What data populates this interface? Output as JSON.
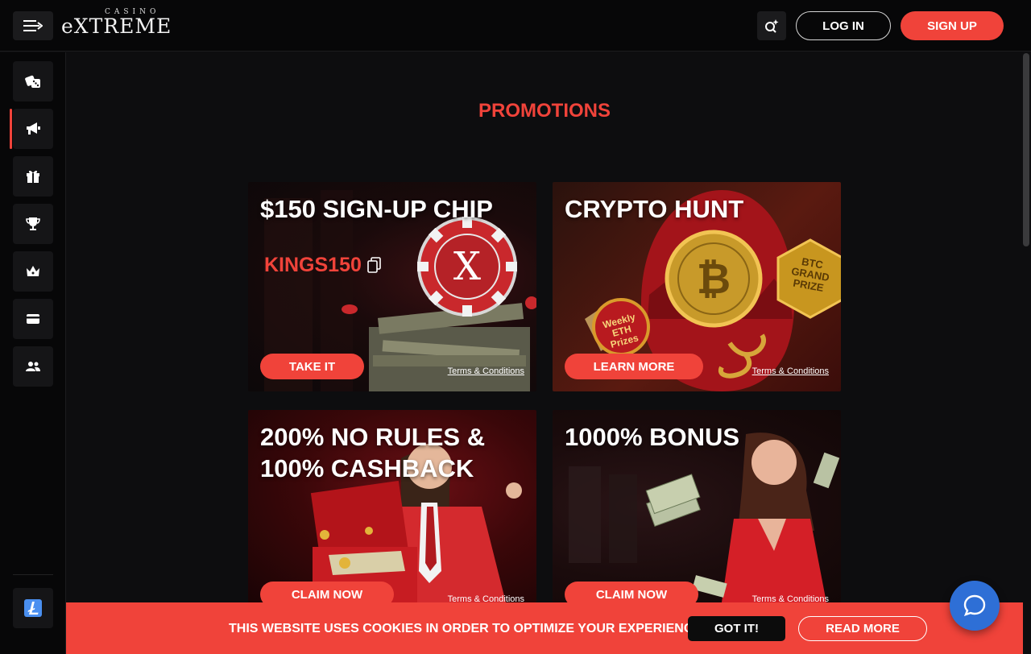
{
  "header": {
    "logo_small": "CASINO",
    "logo_big": "eXTREME",
    "login_label": "LOG IN",
    "signup_label": "SIGN UP"
  },
  "sidebar": {
    "items": [
      {
        "icon": "dice-icon"
      },
      {
        "icon": "megaphone-icon",
        "active": true
      },
      {
        "icon": "gift-icon"
      },
      {
        "icon": "trophy-icon"
      },
      {
        "icon": "crown-icon"
      },
      {
        "icon": "wallet-icon"
      },
      {
        "icon": "users-icon"
      }
    ],
    "bottom_icon": "litecoin-icon"
  },
  "main": {
    "title": "PROMOTIONS",
    "promos": [
      {
        "title": "$150 SIGN-UP CHIP",
        "code": "KINGS150",
        "button": "TAKE IT",
        "terms": "Terms & Conditions"
      },
      {
        "title": "CRYPTO HUNT",
        "badge1": "Weekly ETH Prizes",
        "badge2": "BTC GRAND PRIZE",
        "button": "LEARN MORE",
        "terms": "Terms & Conditions"
      },
      {
        "title_line1": "200% NO RULES &",
        "title_line2": "100% CASHBACK",
        "button": "CLAIM NOW",
        "terms": "Terms & Conditions"
      },
      {
        "title": "1000% BONUS",
        "button": "CLAIM NOW",
        "terms": "Terms & Conditions"
      }
    ]
  },
  "cookie_bar": {
    "text": "THIS WEBSITE USES COOKIES IN ORDER TO OPTIMIZE YOUR EXPERIENCE.",
    "accept_label": "GOT IT!",
    "read_more_label": "READ MORE"
  },
  "colors": {
    "accent": "#f0433a",
    "background": "#0d0d0f",
    "chat": "#2e6fd6"
  }
}
